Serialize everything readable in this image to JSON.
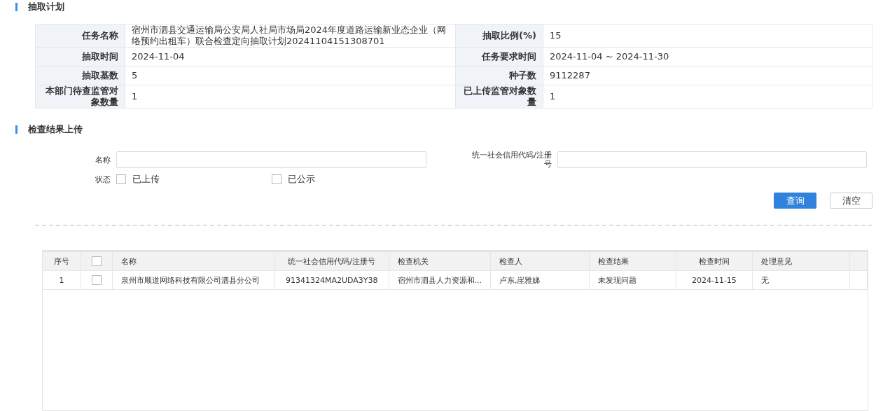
{
  "plan_section": {
    "title": "抽取计划"
  },
  "plan_info": [
    {
      "label": "任务名称",
      "value": "宿州市泗县交通运输局公安局人社局市场局2024年度道路运输新业态企业（网络预约出租车）联合检查定向抽取计划20241104151308701",
      "label_2": "抽取比例(%)",
      "value_2": "15"
    },
    {
      "label": "抽取时间",
      "value": "2024-11-04",
      "label_2": "任务要求时间",
      "value_2": "2024-11-04 ~ 2024-11-30"
    },
    {
      "label": "抽取基数",
      "value": "5",
      "label_2": "种子数",
      "value_2": "9112287"
    },
    {
      "label": "本部门待查监管对象数量",
      "value": "1",
      "label_2": "已上传监管对象数量",
      "value_2": "1"
    }
  ],
  "upload_section": {
    "title": "检查结果上传"
  },
  "filters": {
    "name_label": "名称",
    "code_label": "统一社会信用代码/注册号",
    "status_label": "状态",
    "status_options": [
      {
        "label": "已上传",
        "checked": false
      },
      {
        "label": "已公示",
        "checked": false
      }
    ]
  },
  "buttons": [
    {
      "label": "查询",
      "kind": "primary"
    },
    {
      "label": "清空",
      "kind": "default"
    }
  ],
  "table": {
    "columns": [
      "序号",
      "",
      "名称",
      "统一社会信用代码/注册号",
      "检查机关",
      "检查人",
      "检查结果",
      "检查时间",
      "处理意见"
    ],
    "header_checked": false,
    "rows": [
      {
        "cells": [
          "1",
          "",
          "泉州市顺道网络科技有限公司泗县分公司",
          "91341324MA2UDA3Y38",
          "宿州市泗县人力资源和...",
          "卢东,崖雅娣",
          "未发现问题",
          "2024-11-15",
          "无"
        ],
        "checked": false
      }
    ]
  }
}
